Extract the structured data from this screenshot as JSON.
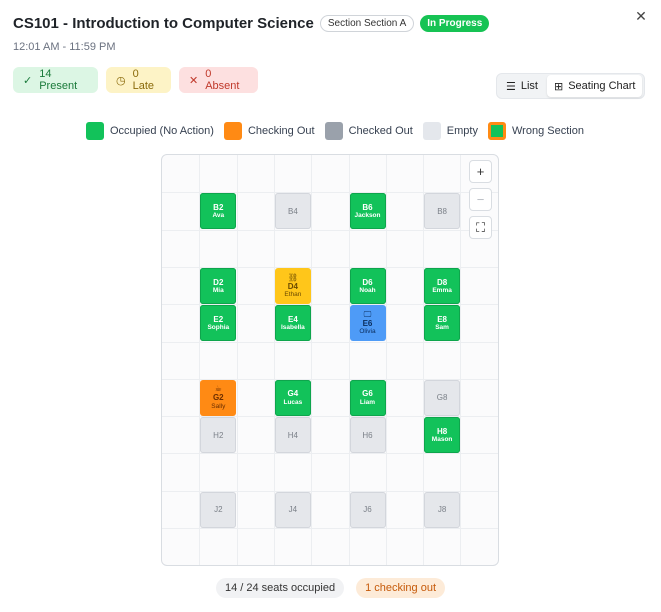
{
  "header": {
    "title": "CS101 - Introduction to Computer Science",
    "section_badge": "Section Section A",
    "status_badge": "In Progress",
    "time_range": "12:01 AM - 11:59 PM",
    "close_icon": "close-icon"
  },
  "stats": {
    "present": "14 Present",
    "late": "0 Late",
    "absent": "0 Absent"
  },
  "view_toggle": {
    "list": "List",
    "seating_chart": "Seating Chart",
    "active": "seating_chart"
  },
  "legend": {
    "occupied": "Occupied (No Action)",
    "checking_out": "Checking Out",
    "checked_out": "Checked Out",
    "empty": "Empty",
    "wrong_section": "Wrong Section"
  },
  "colors": {
    "occupied": "#12c25a",
    "checking_out": "#ff8a14",
    "checked_out": "#9aa1ab",
    "empty": "#e4e7ec",
    "late_seat": "#ffc61a",
    "blue_seat": "#4e9bf7"
  },
  "seats": [
    {
      "code": "B2",
      "name": "Ava",
      "state": "occupied"
    },
    {
      "code": "B4",
      "name": "",
      "state": "empty"
    },
    {
      "code": "B6",
      "name": "Jackson",
      "state": "occupied"
    },
    {
      "code": "B8",
      "name": "",
      "state": "empty"
    },
    {
      "code": "D2",
      "name": "Mia",
      "state": "occupied"
    },
    {
      "code": "D4",
      "name": "Ethan",
      "state": "late",
      "icon": "link-icon"
    },
    {
      "code": "D6",
      "name": "Noah",
      "state": "occupied"
    },
    {
      "code": "D8",
      "name": "Emma",
      "state": "occupied"
    },
    {
      "code": "E2",
      "name": "Sophia",
      "state": "occupied"
    },
    {
      "code": "E4",
      "name": "Isabella",
      "state": "occupied"
    },
    {
      "code": "E6",
      "name": "Olivia",
      "state": "blue",
      "icon": "monitor-icon"
    },
    {
      "code": "E8",
      "name": "Sam",
      "state": "occupied"
    },
    {
      "code": "G2",
      "name": "Sally",
      "state": "checking",
      "icon": "coffee-icon"
    },
    {
      "code": "G4",
      "name": "Lucas",
      "state": "occupied"
    },
    {
      "code": "G6",
      "name": "Liam",
      "state": "occupied"
    },
    {
      "code": "G8",
      "name": "",
      "state": "empty"
    },
    {
      "code": "H2",
      "name": "",
      "state": "empty"
    },
    {
      "code": "H4",
      "name": "",
      "state": "empty"
    },
    {
      "code": "H6",
      "name": "",
      "state": "empty"
    },
    {
      "code": "H8",
      "name": "Mason",
      "state": "occupied"
    },
    {
      "code": "J2",
      "name": "",
      "state": "empty"
    },
    {
      "code": "J4",
      "name": "",
      "state": "empty"
    },
    {
      "code": "J6",
      "name": "",
      "state": "empty"
    },
    {
      "code": "J8",
      "name": "",
      "state": "empty"
    }
  ],
  "footer": {
    "seats_occupied": "14 / 24 seats occupied",
    "checking_out": "1 checking out"
  }
}
